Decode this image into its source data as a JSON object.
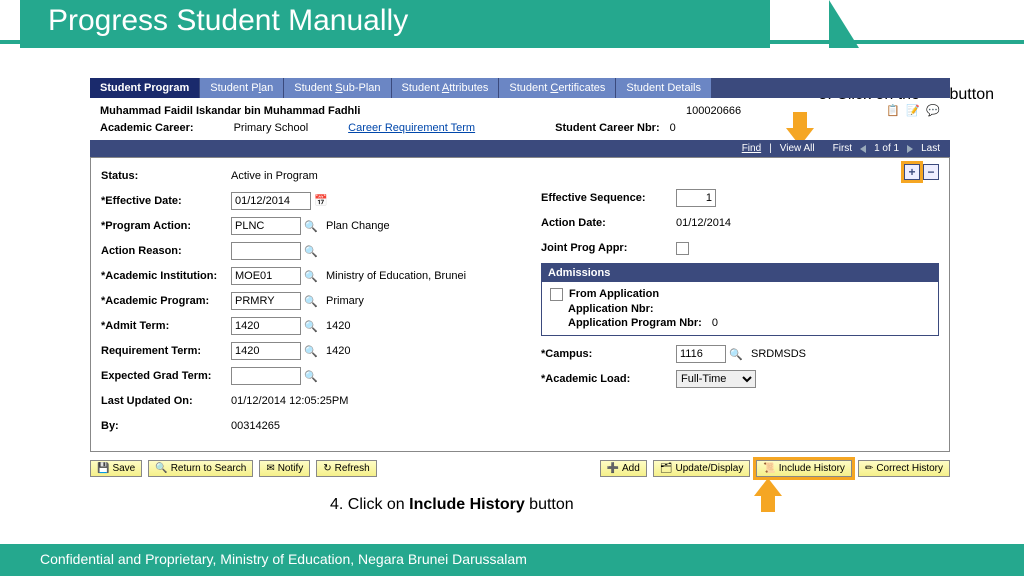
{
  "slide": {
    "title": "Progress Student Manually",
    "callout5": "5. Click on the \"+\" button",
    "callout4": "4. Click on Include History button",
    "footer": "Confidential and Proprietary, Ministry of Education, Negara Brunei Darussalam"
  },
  "tabs": {
    "t0": "Student Program",
    "t1_pre": "Student P",
    "t1_u": "l",
    "t1_post": "an",
    "t2_pre": "Student ",
    "t2_u": "S",
    "t2_post": "ub-Plan",
    "t3_pre": "Student ",
    "t3_u": "A",
    "t3_post": "ttributes",
    "t4_pre": "Student ",
    "t4_u": "C",
    "t4_post": "ertificates",
    "t5": "Student Details"
  },
  "header": {
    "student_name": "Muhammad Faidil Iskandar bin Muhammad Fadhli",
    "student_id": "100020666",
    "academic_career_label": "Academic Career:",
    "academic_career_value": "Primary School",
    "career_req_link": "Career Requirement Term",
    "career_nbr_label": "Student Career Nbr:",
    "career_nbr_value": "0"
  },
  "nav": {
    "find": "Find",
    "view_all": "View All",
    "first": "First",
    "page": "1 of 1",
    "last": "Last"
  },
  "form": {
    "status_label": "Status:",
    "status_value": "Active in Program",
    "eff_date_label": "*Effective Date:",
    "eff_date_value": "01/12/2014",
    "prog_action_label": "*Program Action:",
    "prog_action_value": "PLNC",
    "prog_action_desc": "Plan Change",
    "action_reason_label": "Action Reason:",
    "action_reason_value": "",
    "acad_inst_label": "*Academic Institution:",
    "acad_inst_value": "MOE01",
    "acad_inst_desc": "Ministry of Education, Brunei",
    "acad_prog_label": "*Academic Program:",
    "acad_prog_value": "PRMRY",
    "acad_prog_desc": "Primary",
    "admit_term_label": "*Admit Term:",
    "admit_term_value": "1420",
    "admit_term_desc": "1420",
    "req_term_label": "Requirement Term:",
    "req_term_value": "1420",
    "req_term_desc": "1420",
    "exp_grad_label": "Expected Grad Term:",
    "exp_grad_value": "",
    "last_upd_label": "Last Updated On:",
    "last_upd_value": "01/12/2014 12:05:25PM",
    "by_label": "By:",
    "by_value": "00314265",
    "eff_seq_label": "Effective Sequence:",
    "eff_seq_value": "1",
    "action_date_label": "Action Date:",
    "action_date_value": "01/12/2014",
    "joint_prog_label": "Joint Prog Appr:",
    "admissions_header": "Admissions",
    "from_app_label": "From Application",
    "app_nbr_label": "Application Nbr:",
    "app_prog_nbr_label": "Application Program Nbr:",
    "app_prog_nbr_value": "0",
    "campus_label": "*Campus:",
    "campus_value": "1116",
    "campus_desc": "SRDMSDS",
    "acad_load_label": "*Academic Load:",
    "acad_load_value": "Full-Time"
  },
  "buttons": {
    "save": "Save",
    "return": "Return to Search",
    "notify": "Notify",
    "refresh": "Refresh",
    "add": "Add",
    "update": "Update/Display",
    "include": "Include History",
    "correct": "Correct History"
  }
}
